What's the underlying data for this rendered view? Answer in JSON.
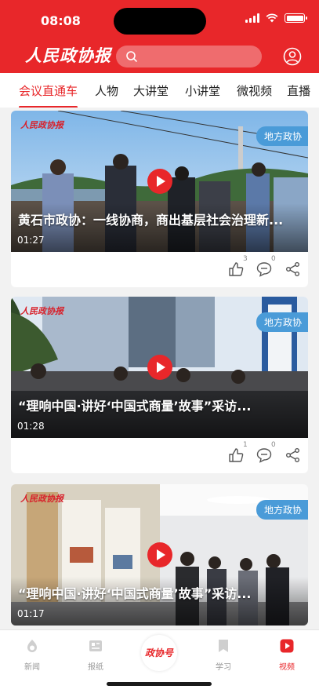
{
  "status_bar": {
    "time": "08:08"
  },
  "header": {
    "logo": "人民政协报",
    "search": {
      "value": "",
      "placeholder": ""
    }
  },
  "tabs": [
    {
      "label": "会议直通车",
      "active": true
    },
    {
      "label": "人物",
      "active": false
    },
    {
      "label": "大讲堂",
      "active": false
    },
    {
      "label": "小讲堂",
      "active": false
    },
    {
      "label": "微视频",
      "active": false
    },
    {
      "label": "直播",
      "active": false
    }
  ],
  "feed": [
    {
      "tag": "地方政协",
      "title": "黄石市政协：一线协商，商出基层社会治理新...",
      "duration": "01:27",
      "watermark": "人民政协报",
      "likes": "3",
      "comments": "0"
    },
    {
      "tag": "地方政协",
      "title": "“理响中国·讲好‘中国式商量’故事”采访...",
      "duration": "01:28",
      "watermark": "人民政协报",
      "likes": "1",
      "comments": "0"
    },
    {
      "tag": "地方政协",
      "title": "“理响中国·讲好‘中国式商量’故事”采访...",
      "duration": "01:17",
      "watermark": "人民政协报",
      "likes": "",
      "comments": ""
    }
  ],
  "bottom_nav": {
    "items": [
      {
        "label": "新闻",
        "icon": "news-icon",
        "active": false
      },
      {
        "label": "报纸",
        "icon": "newspaper-icon",
        "active": false
      },
      {
        "label": "学习",
        "icon": "study-icon",
        "active": false
      },
      {
        "label": "视频",
        "icon": "video-icon",
        "active": true
      }
    ],
    "center_label": "政协号"
  },
  "colors": {
    "brand_red": "#e8272a",
    "tag_blue": "#4a9bd8",
    "inactive_gray": "#999999"
  }
}
